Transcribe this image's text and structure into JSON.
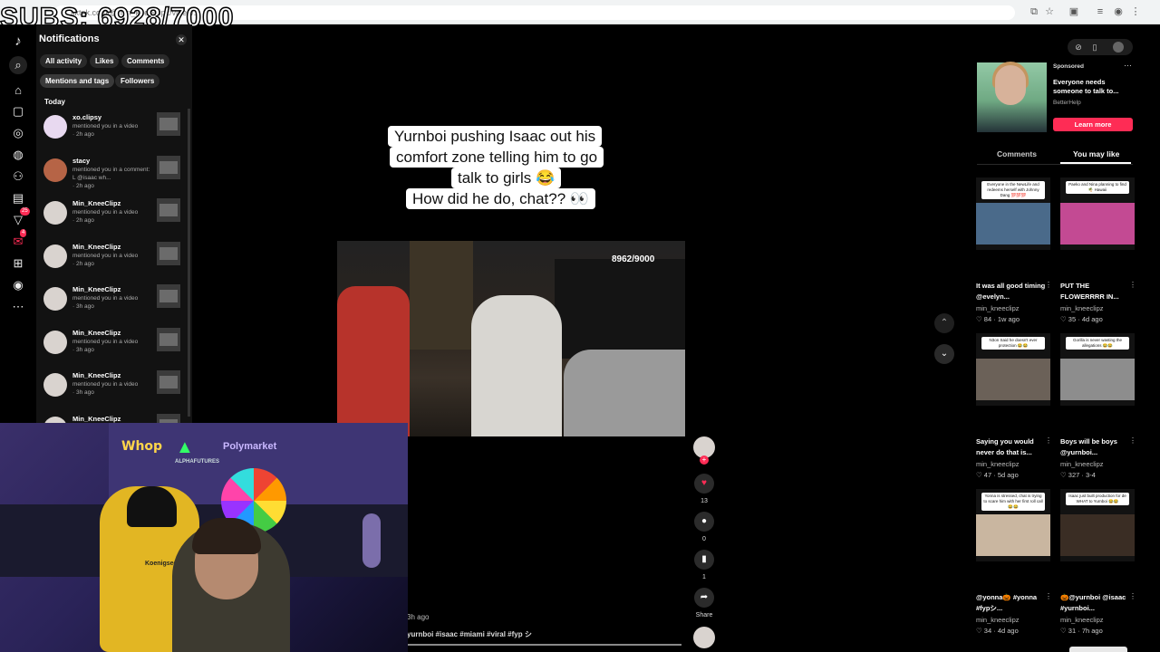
{
  "overlay": {
    "subs": "SUBS: 6928/7000"
  },
  "browser": {
    "url": "tiktok.com/@min_kneeclipz/video/..."
  },
  "notifications": {
    "title": "Notifications",
    "close": "✕",
    "filters": [
      "All activity",
      "Likes",
      "Comments",
      "Mentions and tags",
      "Followers"
    ],
    "today_label": "Today",
    "items": [
      {
        "user": "xo.clipsy",
        "text": "mentioned you in a video",
        "time": "· 2h ago"
      },
      {
        "user": "stacy",
        "text": "mentioned you in a comment: L @isaac wh...",
        "time": "· 2h ago"
      },
      {
        "user": "Min_KneeClipz",
        "text": "mentioned you in a video",
        "time": "· 2h ago"
      },
      {
        "user": "Min_KneeClipz",
        "text": "mentioned you in a video",
        "time": "· 2h ago"
      },
      {
        "user": "Min_KneeClipz",
        "text": "mentioned you in a video",
        "time": "· 3h ago"
      },
      {
        "user": "Min_KneeClipz",
        "text": "mentioned you in a video",
        "time": "· 3h ago"
      },
      {
        "user": "Min_KneeClipz",
        "text": "mentioned you in a video",
        "time": "· 3h ago"
      },
      {
        "user": "Min_KneeClipz",
        "text": "",
        "time": ""
      }
    ]
  },
  "nav": {
    "badge1": "25",
    "badge2": "4"
  },
  "video": {
    "caption_lines": [
      "Yurnboi pushing Isaac out his",
      "comfort zone telling him to go",
      "talk to girls 😂",
      "How did he do, chat?? 👀"
    ],
    "counter": "8962/9000",
    "likes": "13",
    "comments": "0",
    "saves": "1",
    "share_label": "Share",
    "time_ago": "3h ago",
    "hashtags": "yurnboi #isaac #miami #viral #fyp シ",
    "progress": 1.0
  },
  "webcam": {
    "logo1": "Whop",
    "logo3": "Polymarket",
    "logo4": "ALPHAFUTURES",
    "chair": "Koenigsegg"
  },
  "ad": {
    "label": "Sponsored",
    "text": "Everyone needs someone to talk to...",
    "brand": "BetterHelp",
    "cta": "Learn more"
  },
  "tabs": {
    "comments": "Comments",
    "you_may_like": "You may like"
  },
  "cards": [
    {
      "thumb_caption": "Everyone in the NewLife and redeems herself with Johnny Dang 💯💯💯",
      "title": "It was all good timing @evelyn...",
      "author": "min_kneeclipz",
      "meta": "♡ 84 · 1w ago",
      "pic": "#4a6a8a"
    },
    {
      "thumb_caption": "Paeko and Nina planning to find 🌴 Hawaii",
      "title": "PUT THE FLOWERRRR IN...",
      "author": "min_kneeclipz",
      "meta": "♡ 35 · 4d ago",
      "pic": "#c34a93"
    },
    {
      "thumb_caption": "N3on Said he doesn't ever protection 😂😂",
      "title": "Saying you would never do that is...",
      "author": "min_kneeclipz",
      "meta": "♡ 47 · 5d ago",
      "pic": "#6b6158"
    },
    {
      "thumb_caption": "Gorilla is never wasting the allegations 😂😂",
      "title": "Boys will be boys @yurnboi...",
      "author": "min_kneeclipz",
      "meta": "♡ 327 · 3-4",
      "pic": "#8d8d8d"
    },
    {
      "thumb_caption": "Yonna is stressed, chat is trying to scare him with her first roll call 😂😂",
      "title": "@yonna🎃 #yonna #fypシ...",
      "author": "min_kneeclipz",
      "meta": "♡ 34 · 4d ago",
      "pic": "#c9b6a0"
    },
    {
      "thumb_caption": "Isaac just built production for de WHAT to Yurnboi 😂😂",
      "title": "🎃@yurnboi @isaac #yurnboi...",
      "author": "min_kneeclipz",
      "meta": "♡ 31 · 7h ago",
      "pic": "#3a2d24"
    }
  ]
}
